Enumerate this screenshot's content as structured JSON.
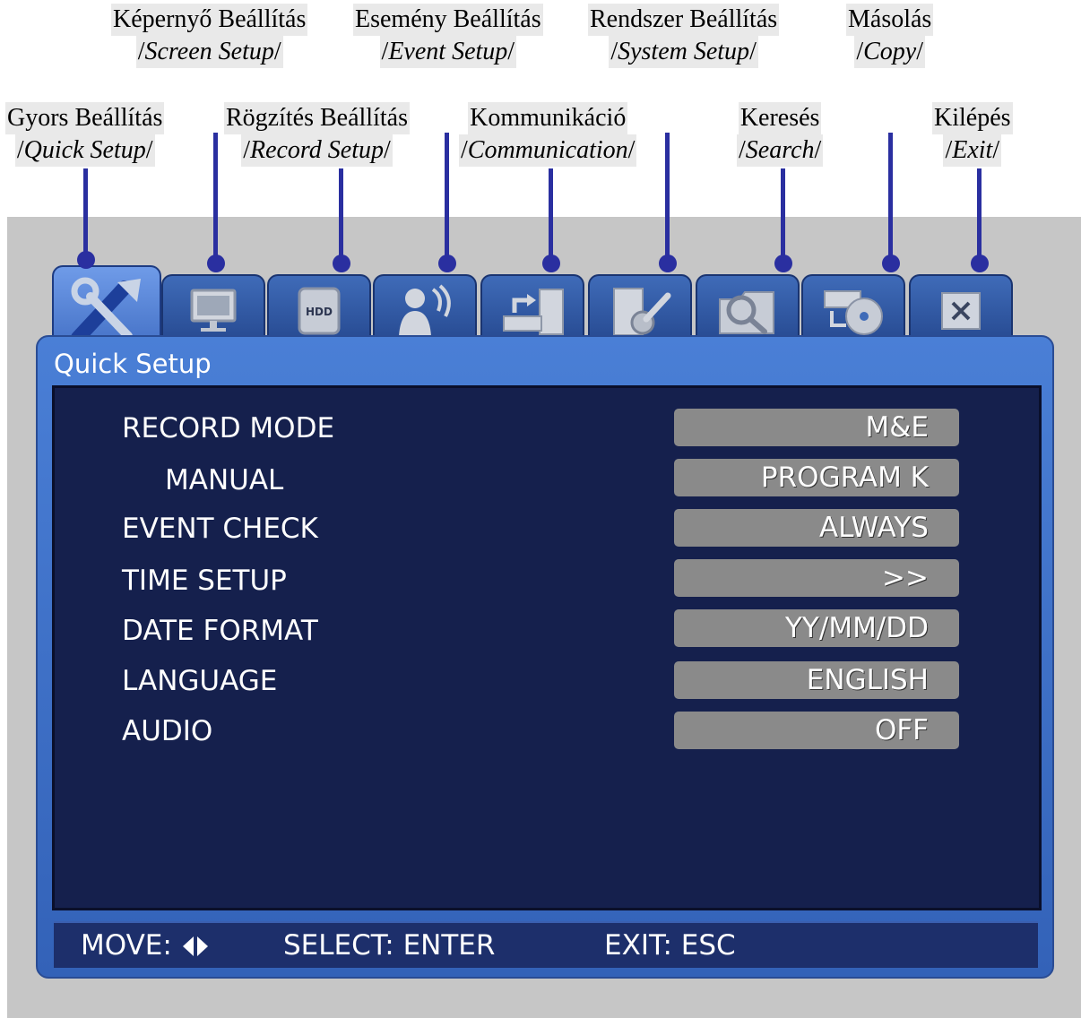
{
  "callouts": {
    "screen_setup": {
      "hu": "Képernyő Beállítás",
      "en": "Screen Setup"
    },
    "event_setup": {
      "hu": "Esemény Beállítás",
      "en": "Event Setup"
    },
    "system_setup": {
      "hu": "Rendszer Beállítás",
      "en": "System Setup"
    },
    "copy": {
      "hu": "Másolás",
      "en": "Copy"
    },
    "quick_setup": {
      "hu": "Gyors Beállítás",
      "en": "Quick Setup"
    },
    "record_setup": {
      "hu": "Rögzítés Beállítás",
      "en": "Record Setup"
    },
    "communication": {
      "hu": "Kommunikáció",
      "en": "Communication"
    },
    "search": {
      "hu": "Keresés",
      "en": "Search"
    },
    "exit": {
      "hu": "Kilépés",
      "en": "Exit"
    }
  },
  "tabs": [
    {
      "icon": "tools-icon",
      "active": true
    },
    {
      "icon": "monitor-icon"
    },
    {
      "icon": "hdd-icon",
      "text": "HDD"
    },
    {
      "icon": "person-signal-icon"
    },
    {
      "icon": "network-icon"
    },
    {
      "icon": "system-tools-icon"
    },
    {
      "icon": "search-folder-icon"
    },
    {
      "icon": "copy-disc-icon"
    },
    {
      "icon": "close-icon"
    }
  ],
  "panel": {
    "title": "Quick Setup",
    "rows": [
      {
        "label": "RECORD MODE",
        "value": "M&E"
      },
      {
        "label": "MANUAL",
        "value": "PROGRAM K"
      },
      {
        "label": "EVENT CHECK",
        "value": "ALWAYS"
      },
      {
        "label": "TIME SETUP",
        "value": ">>"
      },
      {
        "label": "DATE FORMAT",
        "value": "YY/MM/DD"
      },
      {
        "label": "LANGUAGE",
        "value": "ENGLISH"
      },
      {
        "label": "AUDIO",
        "value": "OFF"
      }
    ]
  },
  "status_bar": {
    "move": "MOVE:",
    "select": "SELECT: ENTER",
    "exit": "EXIT: ESC"
  },
  "colors": {
    "leader": "#2a2fa0",
    "panel": "#3362b8",
    "panel_body": "#15204d",
    "value_box": "#8a8a8a"
  }
}
